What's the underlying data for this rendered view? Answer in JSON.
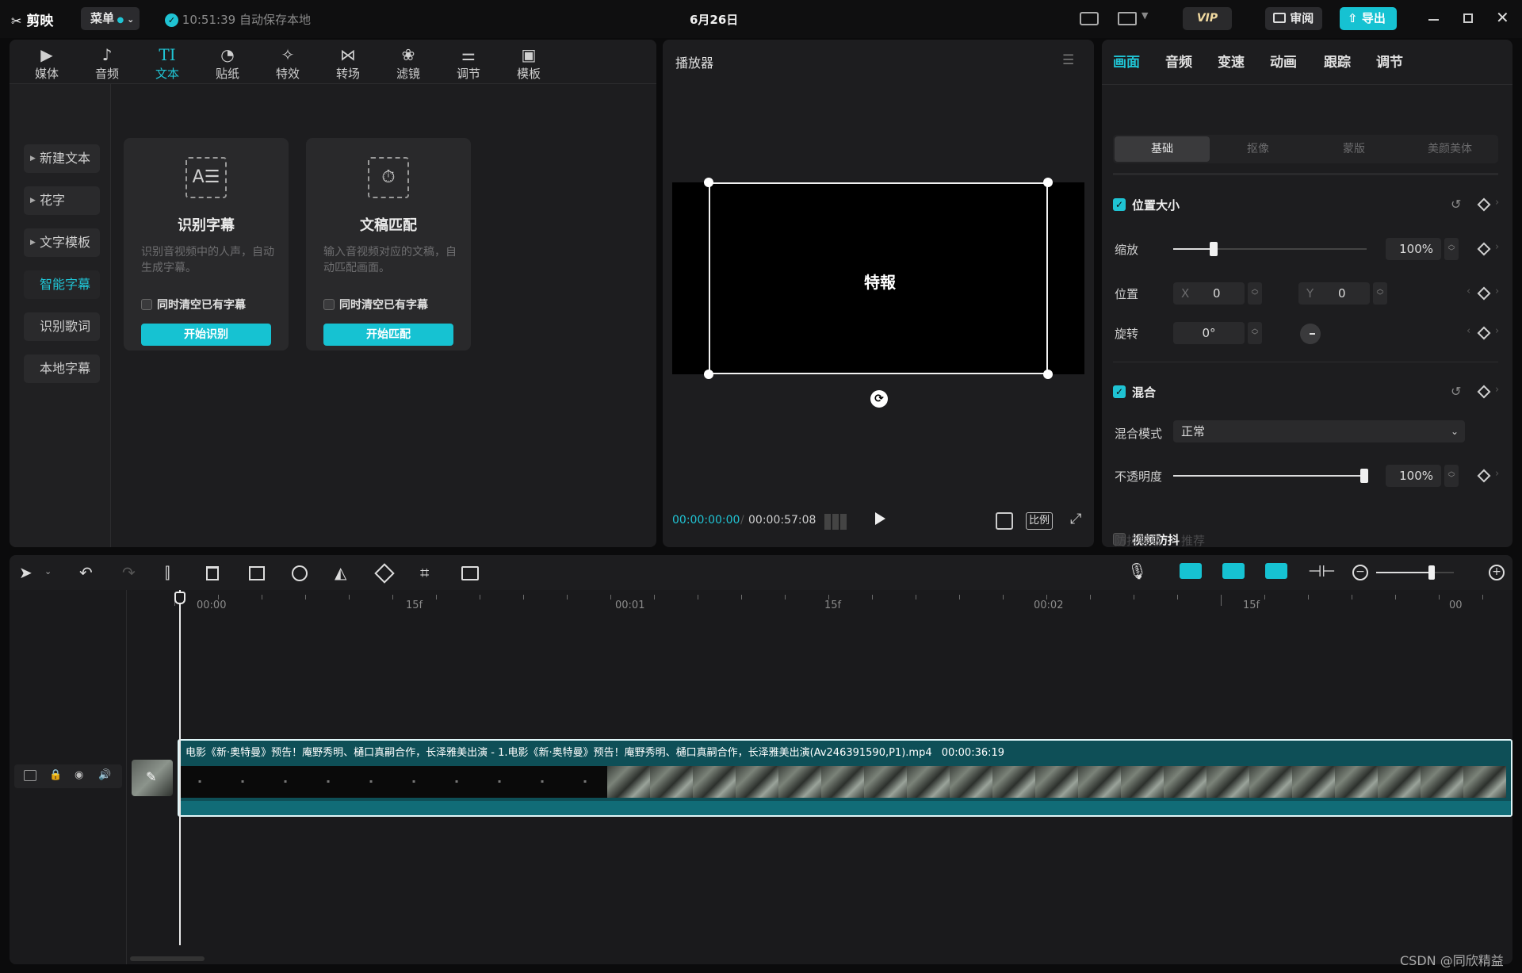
{
  "titlebar": {
    "logo": "剪映",
    "menu_label": "菜单",
    "save_time": "10:51:39",
    "save_text": "自动保存本地",
    "project_name": "6月26日",
    "vip_label": "VIP",
    "review_label": "审阅",
    "export_label": "导出"
  },
  "toolbar": {
    "items": [
      {
        "label": "媒体",
        "icon": "media-icon"
      },
      {
        "label": "音频",
        "icon": "audio-icon"
      },
      {
        "label": "文本",
        "icon": "text-icon",
        "active": true
      },
      {
        "label": "贴纸",
        "icon": "sticker-icon"
      },
      {
        "label": "特效",
        "icon": "effects-icon"
      },
      {
        "label": "转场",
        "icon": "transition-icon"
      },
      {
        "label": "滤镜",
        "icon": "filter-icon"
      },
      {
        "label": "调节",
        "icon": "adjust-icon"
      },
      {
        "label": "模板",
        "icon": "template-icon"
      }
    ]
  },
  "text_sidebar": {
    "items": [
      {
        "label": "新建文本",
        "expandable": true
      },
      {
        "label": "花字",
        "expandable": true
      },
      {
        "label": "文字模板",
        "expandable": true
      },
      {
        "label": "智能字幕",
        "active": true
      },
      {
        "label": "识别歌词"
      },
      {
        "label": "本地字幕"
      }
    ]
  },
  "cards": [
    {
      "title": "识别字幕",
      "desc": "识别音视频中的人声，自动生成字幕。",
      "check_label": "同时清空已有字幕",
      "button": "开始识别"
    },
    {
      "title": "文稿匹配",
      "desc": "输入音视频对应的文稿，自动匹配画面。",
      "check_label": "同时清空已有字幕",
      "button": "开始匹配"
    }
  ],
  "player": {
    "title": "播放器",
    "overlay_text": "特報",
    "current_time": "00:00:00:00",
    "total_time": "00:00:57:08",
    "ratio_label": "比例"
  },
  "inspector": {
    "tabs": [
      "画面",
      "音频",
      "变速",
      "动画",
      "跟踪",
      "调节"
    ],
    "active_tab": "画面",
    "segments": [
      "基础",
      "抠像",
      "蒙版",
      "美颜美体"
    ],
    "active_segment": "基础",
    "position_size": {
      "title": "位置大小",
      "scale_label": "缩放",
      "scale_value": "100%",
      "scale_fraction": 0.2,
      "position_label": "位置",
      "x_label": "X",
      "x_value": "0",
      "y_label": "Y",
      "y_value": "0",
      "rotate_label": "旋转",
      "rotate_value": "0°"
    },
    "blend": {
      "title": "混合",
      "mode_label": "混合模式",
      "mode_value": "正常",
      "opacity_label": "不透明度",
      "opacity_value": "100%",
      "opacity_fraction": 1.0
    },
    "stabilize": {
      "title": "视频防抖",
      "level_label": "防抖等级",
      "level_value": "推荐"
    }
  },
  "timeline": {
    "ruler_labels": [
      "00:00",
      "15f",
      "00:01",
      "15f",
      "00:02",
      "15f",
      "00"
    ],
    "zoom_fraction": 0.7,
    "clip_label": "电影《新·奥特曼》预告！庵野秀明、樋口真嗣合作，长泽雅美出演 - 1.电影《新·奥特曼》预告！庵野秀明、樋口真嗣合作，长泽雅美出演(Av246391590,P1).mp4",
    "clip_duration": "00:00:36:19",
    "watermark": "CSDN @同欣精益"
  },
  "colors": {
    "accent": "#20c4d4",
    "background": "#0b0b0c",
    "panel": "#1d1d1f",
    "clip": "#0e4f57"
  }
}
